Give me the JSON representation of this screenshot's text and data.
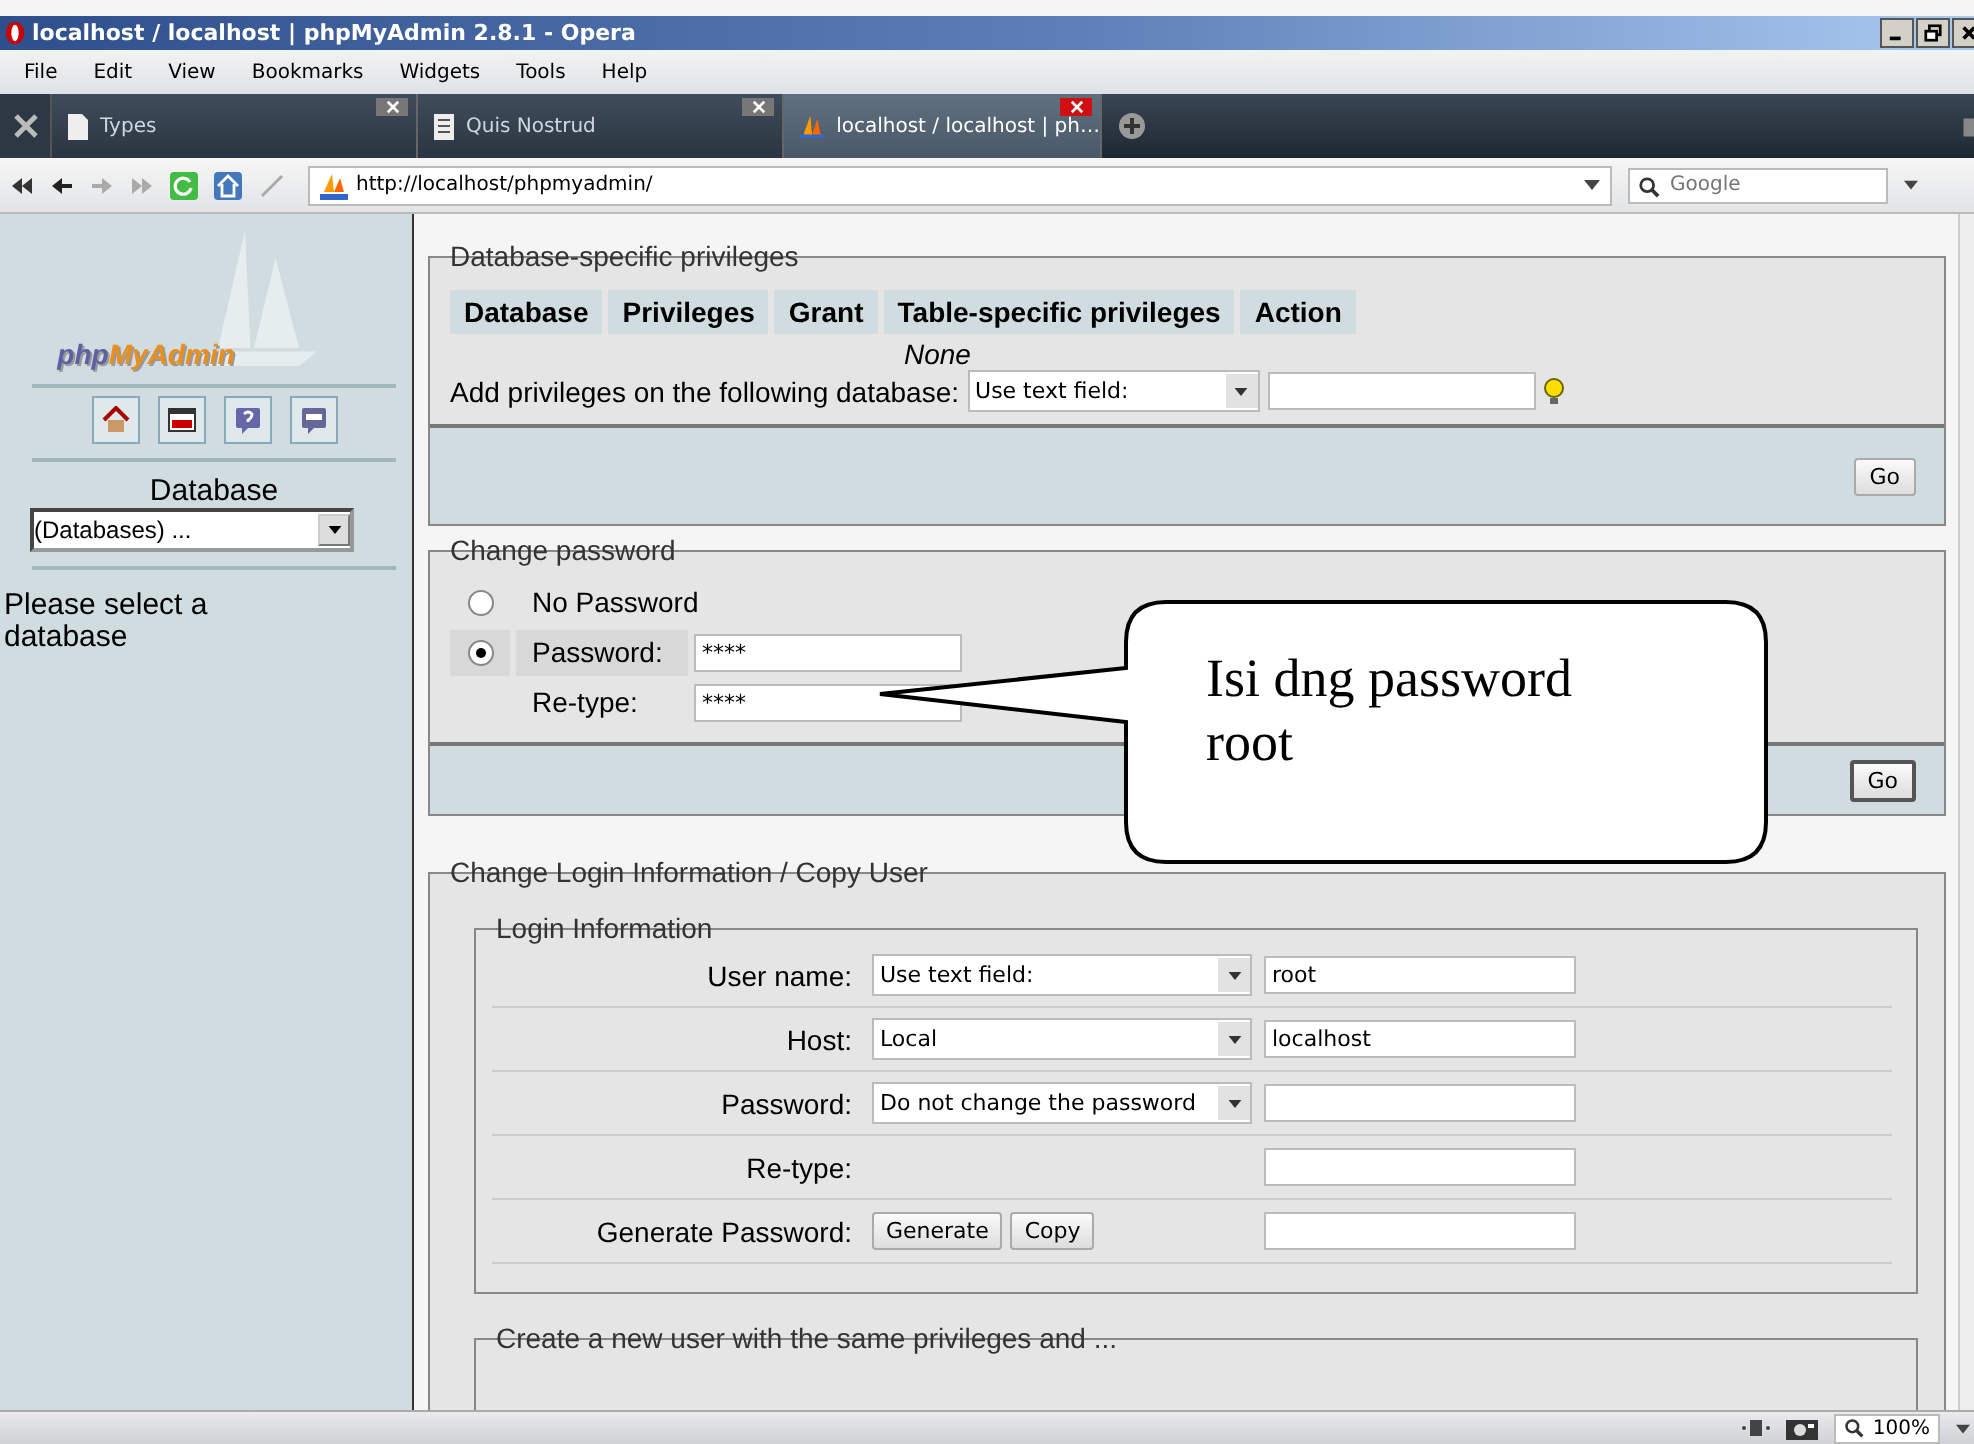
{
  "window": {
    "title": "localhost / localhost | phpMyAdmin 2.8.1 - Opera"
  },
  "menu": [
    "File",
    "Edit",
    "View",
    "Bookmarks",
    "Widgets",
    "Tools",
    "Help"
  ],
  "tabs": [
    {
      "label": "Types",
      "selected": false
    },
    {
      "label": "Quis Nostrud",
      "selected": false
    },
    {
      "label": "localhost / localhost | ph…",
      "selected": true
    }
  ],
  "address": {
    "url": "http://localhost/phpmyadmin/",
    "search_placeholder": "Google"
  },
  "sidebar": {
    "logo_parts": [
      "php",
      "MyAdmin"
    ],
    "database_label": "Database",
    "database_select": "(Databases) ...",
    "message": "Please select a database"
  },
  "privileges": {
    "legend": "Database-specific privileges",
    "columns": [
      "Database",
      "Privileges",
      "Grant",
      "Table-specific privileges",
      "Action"
    ],
    "empty": "None",
    "add_label": "Add privileges on the following database:",
    "add_select": "Use text field:",
    "button": "Go"
  },
  "change_password": {
    "legend": "Change password",
    "rows": [
      {
        "kind": "radio",
        "label": "No Password",
        "selected": false
      },
      {
        "kind": "radio",
        "label": "Password:",
        "selected": true,
        "value": "****"
      },
      {
        "kind": "field",
        "label": "Re-type:",
        "value": "****"
      }
    ],
    "button": "Go"
  },
  "callout": {
    "text": "Isi dng password root"
  },
  "login": {
    "legend": "Change Login Information / Copy User",
    "inner_legend": "Login Information",
    "rows": [
      {
        "kind": "select",
        "label": "User name:",
        "select": "Use text field:",
        "value": "root"
      },
      {
        "kind": "select",
        "label": "Host:",
        "select": "Local",
        "value": "localhost"
      },
      {
        "kind": "select",
        "label": "Password:",
        "select": "Do not change the password"
      },
      {
        "kind": "field",
        "label": "Re-type:"
      },
      {
        "kind": "buttons",
        "label": "Generate Password:",
        "buttons": [
          "Generate",
          "Copy"
        ]
      }
    ],
    "next_legend": "Create a new user with the same privileges and ..."
  },
  "status_bar": {
    "zoom": "100%"
  }
}
